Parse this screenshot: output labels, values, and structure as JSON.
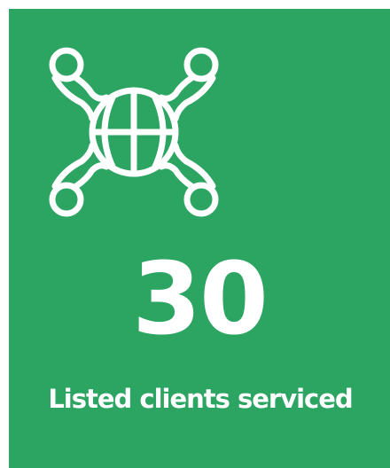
{
  "colors": {
    "background": "#2ca562",
    "foreground": "#ffffff"
  },
  "stat": {
    "icon": "basketball-team-icon",
    "number": "30",
    "label": "Listed clients serviced"
  }
}
